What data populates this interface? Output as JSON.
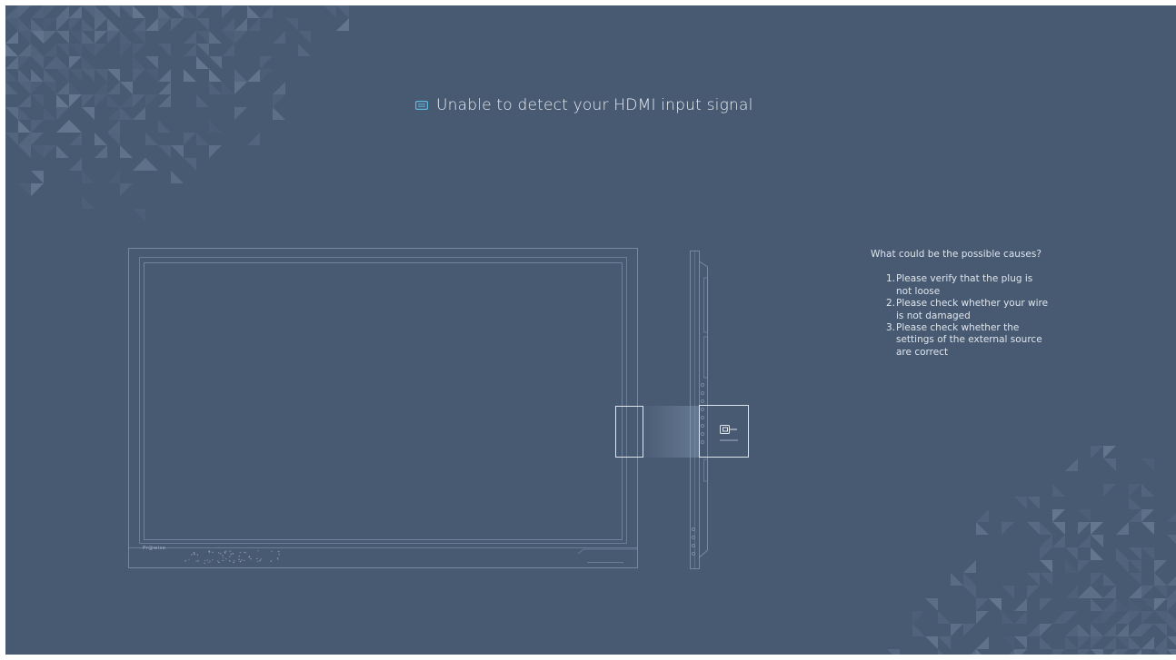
{
  "message": {
    "icon": "hdmi-icon",
    "title": "Unable to detect your HDMI input signal"
  },
  "causes": {
    "heading": "What could be the possible causes?",
    "items": [
      {
        "num": "1.",
        "text": "Please verify that the plug is not loose"
      },
      {
        "num": "2.",
        "text": "Please check whether your wire is not damaged"
      },
      {
        "num": "3.",
        "text": "Please check whether the settings of the external source are correct"
      }
    ]
  },
  "display_illustration": {
    "brand": "Pr@wise"
  },
  "colors": {
    "background": "#485a72",
    "line": "#8aa0b9",
    "text": "#dfe5ec",
    "accent": "#5fb8e0"
  }
}
